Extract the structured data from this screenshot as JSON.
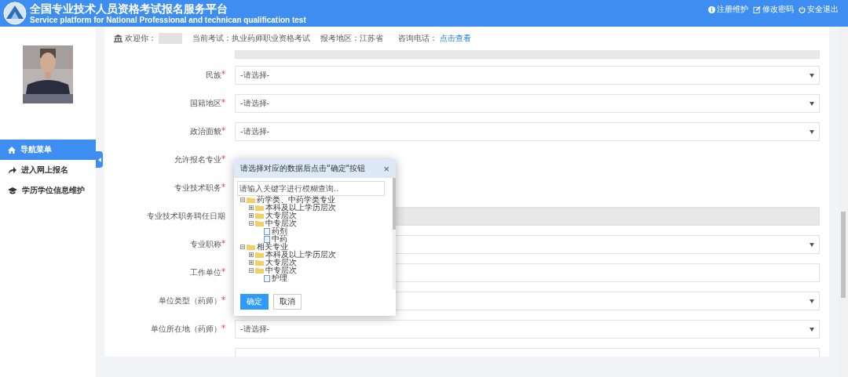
{
  "header": {
    "title": "全国专业技术人员资格考试报名服务平台",
    "subtitle": "Service platform for National Professional and technican qualification test",
    "links": [
      {
        "kind": "info",
        "label": "注册维护"
      },
      {
        "kind": "edit",
        "label": "修改密码"
      },
      {
        "kind": "power",
        "label": "安全退出"
      }
    ]
  },
  "sidebar": {
    "items": [
      {
        "kind": "home",
        "label": "导航菜单",
        "selected": true
      },
      {
        "kind": "share",
        "label": "进入网上报名",
        "selected": false
      },
      {
        "kind": "cap",
        "label": "学历学位信息维护",
        "selected": false
      }
    ]
  },
  "info_bar": {
    "welcome": "欢迎你：",
    "exam": "当前考试：执业药师职业资格考试",
    "region": "报考地区：江苏省",
    "phone_label": "咨询电话：",
    "phone_link": "点击查看"
  },
  "form": {
    "rows": [
      {
        "kind": "disabled"
      },
      {
        "label": "民族",
        "required_mark": "*",
        "kind": "select",
        "placeholder": "-请选择-"
      },
      {
        "label": "国籍地区",
        "required_mark": "*",
        "kind": "select",
        "placeholder": "-请选择-"
      },
      {
        "label": "政治面貌",
        "required_mark": "*",
        "kind": "select",
        "placeholder": "-请选择-"
      },
      {
        "label": "允许报名专业",
        "required_mark": "*",
        "kind": "none"
      },
      {
        "label": "专业技术职务",
        "required_mark": "*",
        "kind": "none"
      },
      {
        "label": "专业技术职务聘任日期",
        "kind": "disabled"
      },
      {
        "label": "专业职称",
        "required_mark": "*",
        "kind": "select"
      },
      {
        "label": "工作单位",
        "required_mark": "*",
        "kind": "input"
      },
      {
        "label": "单位类型（药师）",
        "required_mark": "*",
        "kind": "select"
      },
      {
        "label": "单位所在地（药师）",
        "required_mark": "*",
        "kind": "select",
        "placeholder": "-请选择-"
      },
      {
        "kind": "input"
      }
    ]
  },
  "dialog": {
    "title": "请选择对应的数据后点击\"确定\"按钮",
    "close": "×",
    "search": {
      "placeholder": "请输入关键字进行模糊查询.."
    },
    "tree": [
      {
        "label": "药学类、中药学类专业",
        "kind": "folder",
        "expanded": true,
        "children": [
          {
            "label": "本科及以上学历层次",
            "kind": "folder",
            "expanded": false
          },
          {
            "label": "大专层次",
            "kind": "folder",
            "expanded": false
          },
          {
            "label": "中专层次",
            "kind": "folder",
            "expanded": true,
            "children": [
              {
                "label": "药剂",
                "kind": "file"
              },
              {
                "label": "中药",
                "kind": "file"
              }
            ]
          }
        ]
      },
      {
        "label": "相关专业",
        "kind": "folder",
        "expanded": true,
        "children": [
          {
            "label": "本科及以上学历层次",
            "kind": "folder",
            "expanded": false
          },
          {
            "label": "大专层次",
            "kind": "folder",
            "expanded": false
          },
          {
            "label": "中专层次",
            "kind": "folder",
            "expanded": true,
            "children": [
              {
                "label": "护理",
                "kind": "file"
              }
            ]
          }
        ]
      }
    ],
    "buttons": [
      {
        "kind": "primary",
        "label": "确定"
      },
      {
        "kind": "default",
        "label": "取消"
      }
    ]
  }
}
